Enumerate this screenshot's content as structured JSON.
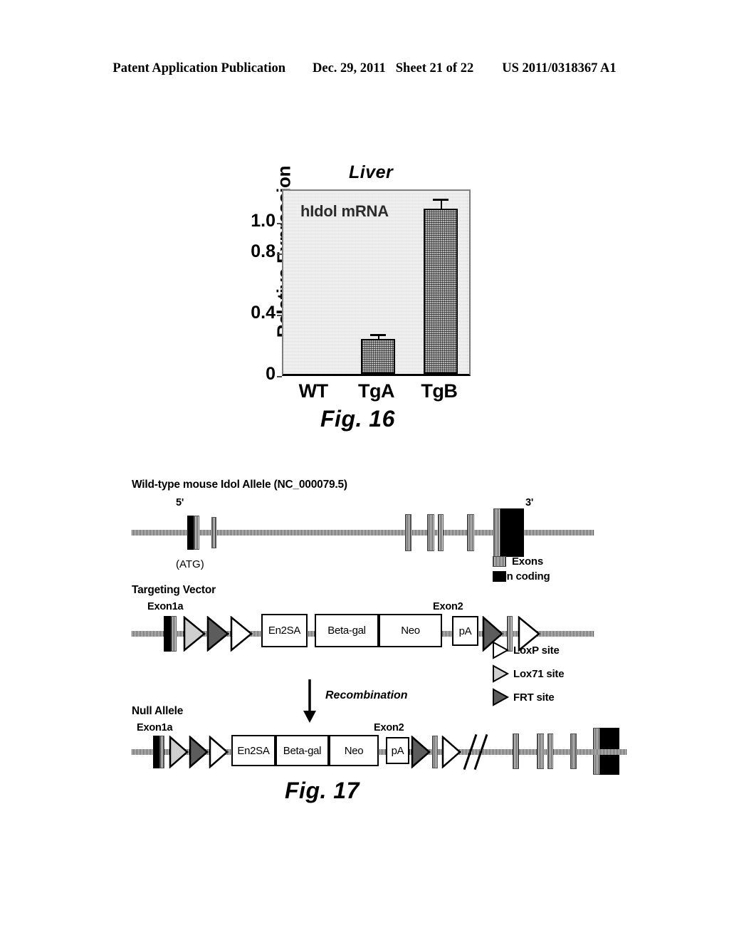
{
  "header": {
    "publication": "Patent Application Publication",
    "date": "Dec. 29, 2011",
    "sheet": "Sheet 21 of 22",
    "number": "US 2011/0318367 A1"
  },
  "figure16": {
    "caption": "Fig. 16",
    "colors": {
      "bar_fill": "#b6b6b6",
      "plot_bg": "#f2f2f2",
      "axis": "#000000"
    }
  },
  "chart_data": {
    "type": "bar",
    "title": "Liver",
    "annotation": "hIdol mRNA",
    "xlabel": "",
    "ylabel": "Relative Expression",
    "categories": [
      "WT",
      "TgA",
      "TgB"
    ],
    "values": [
      0.0,
      0.23,
      1.08
    ],
    "errors": [
      0.0,
      0.015,
      0.05
    ],
    "ytick_labels": [
      "0",
      "0.4",
      "0.8",
      "1.0"
    ],
    "ytick_values": [
      0,
      0.4,
      0.8,
      1.0
    ],
    "ylim": [
      0,
      1.22
    ],
    "grid": false,
    "legend": "none"
  },
  "figure17": {
    "caption": "Fig. 17",
    "panels": {
      "wildtype": {
        "heading": "Wild-type mouse Idol Allele (NC_000079.5)",
        "five_prime": "5'",
        "three_prime": "3'",
        "atg": "(ATG)"
      },
      "targeting_vector": {
        "heading": "Targeting Vector",
        "exon1a": "Exon1a",
        "exon2": "Exon2",
        "boxes": [
          "En2SA",
          "Beta-gal",
          "Neo",
          "pA"
        ]
      },
      "recombination": "Recombination",
      "null_allele": {
        "heading": "Null Allele",
        "exon1a": "Exon1a",
        "exon2": "Exon2",
        "boxes": [
          "En2SA",
          "Beta-gal",
          "Neo",
          "pA"
        ]
      }
    },
    "legends": {
      "allele": [
        {
          "label": "Exons",
          "swatch": "hatched"
        },
        {
          "label": "Non coding",
          "swatch": "black"
        }
      ],
      "sites": [
        {
          "label": "LoxP site",
          "arrow": "white"
        },
        {
          "label": "Lox71 site",
          "arrow": "light-gray"
        },
        {
          "label": "FRT site",
          "arrow": "dark-gray"
        }
      ]
    }
  }
}
